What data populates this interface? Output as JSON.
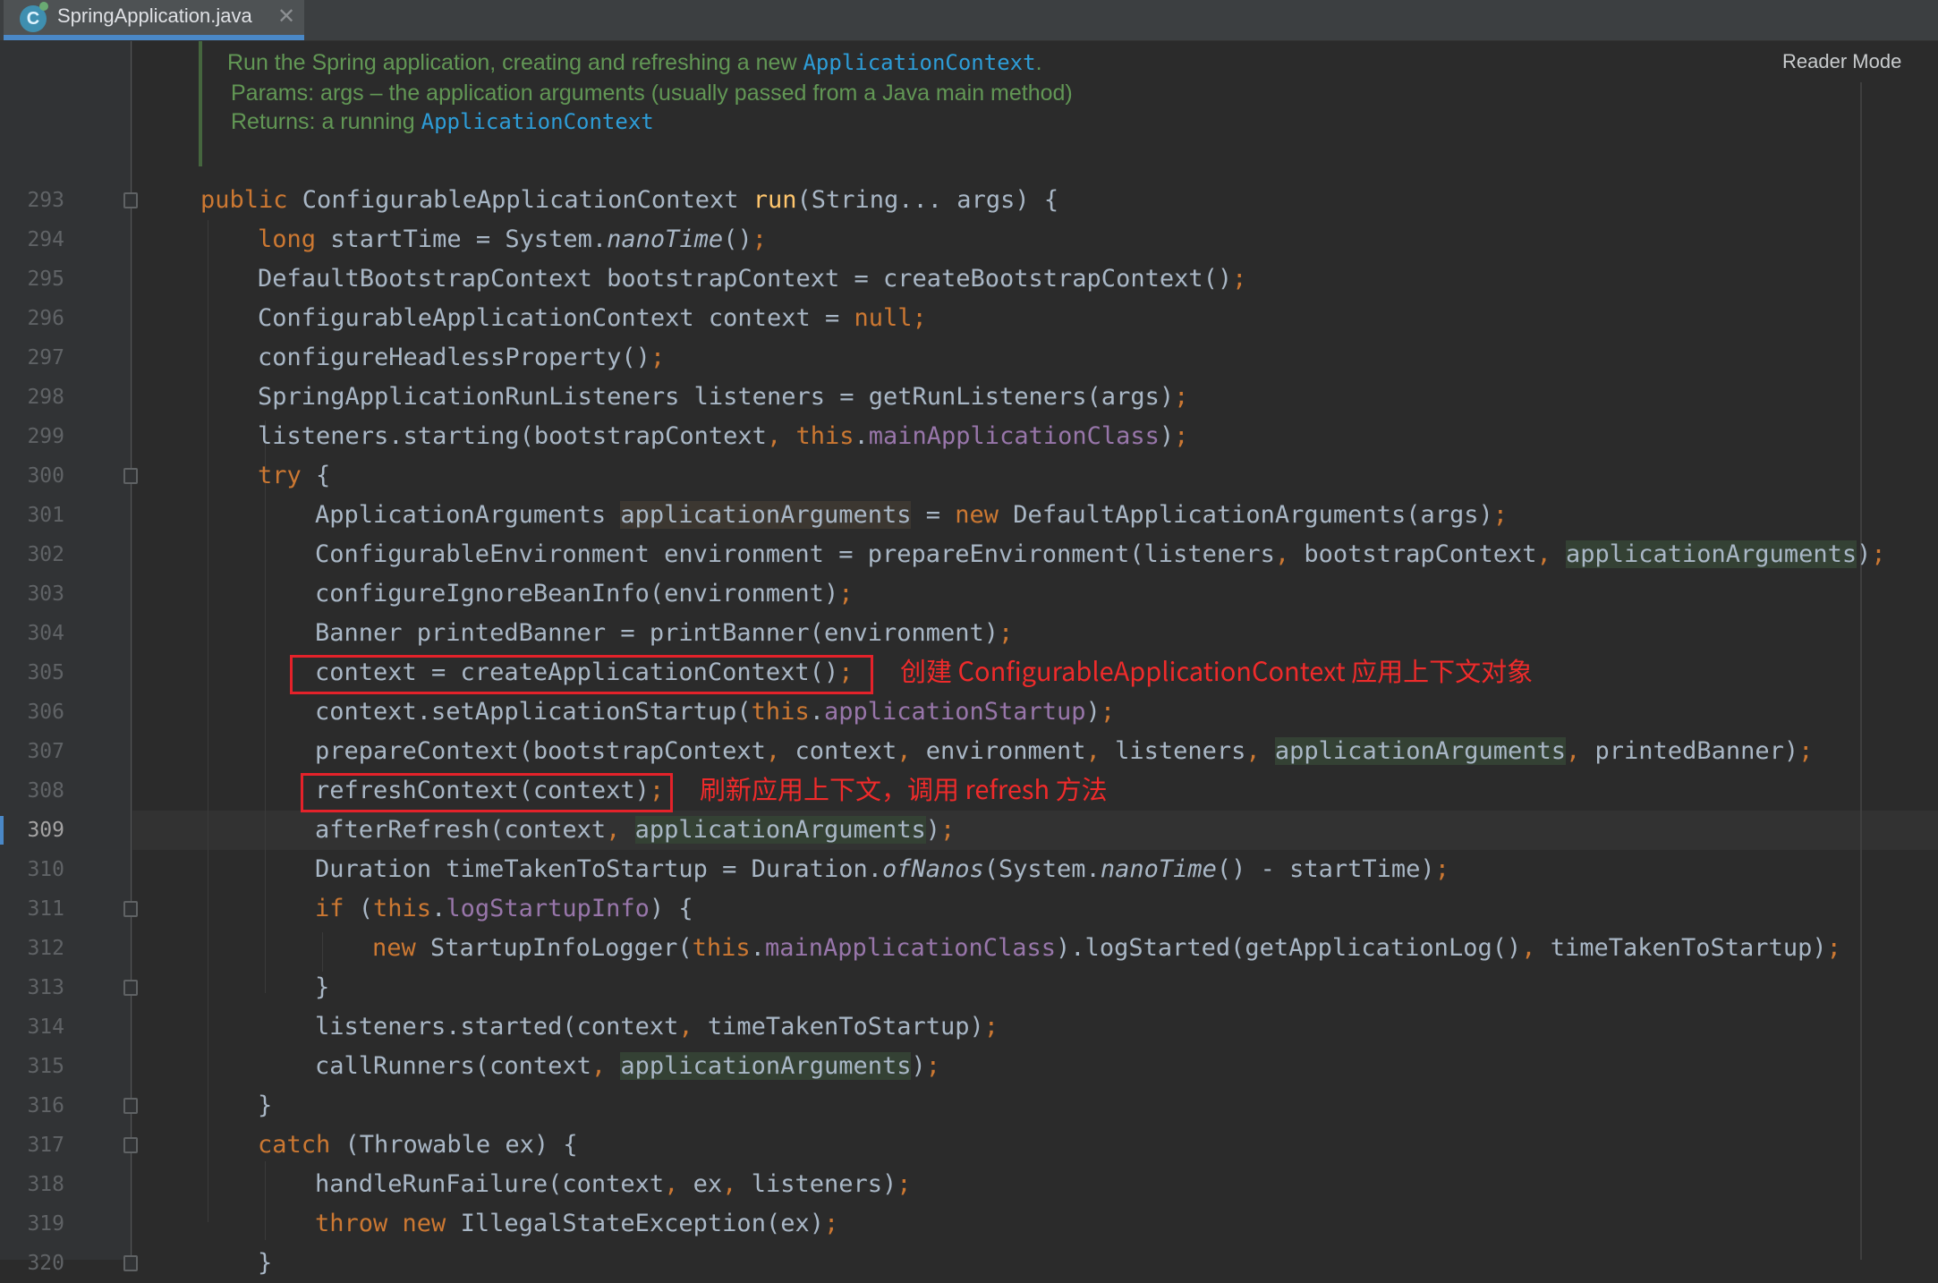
{
  "tab": {
    "title": "SpringApplication.java",
    "icon": "C",
    "close": "✕"
  },
  "reader_mode": "Reader Mode",
  "doc": {
    "summary_text": "Run the Spring application, creating and refreshing a new ",
    "summary_link": "ApplicationContext",
    "summary_end": ".",
    "params_label": "Params:",
    "params_text": "args – the application arguments (usually passed from a Java main method)",
    "returns_label": "Returns:",
    "returns_text": "a running ",
    "returns_link": "ApplicationContext"
  },
  "line_numbers": [
    "293",
    "294",
    "295",
    "296",
    "297",
    "298",
    "299",
    "300",
    "301",
    "302",
    "303",
    "304",
    "305",
    "306",
    "307",
    "308",
    "309",
    "310",
    "311",
    "312",
    "313",
    "314",
    "315",
    "316",
    "317",
    "318",
    "319",
    "320"
  ],
  "code": {
    "l293": [
      "public",
      " ConfigurableApplicationContext ",
      "run",
      "(String... args) {"
    ],
    "l294": [
      "long",
      " startTime = System.",
      "nanoTime",
      "()",
      ";"
    ],
    "l295": [
      "DefaultBootstrapContext bootstrapContext = createBootstrapContext()",
      ";"
    ],
    "l296": [
      "ConfigurableApplicationContext context = ",
      "null",
      ";"
    ],
    "l297": [
      "configureHeadlessProperty()",
      ";"
    ],
    "l298": [
      "SpringApplicationRunListeners listeners = getRunListeners(args)",
      ";"
    ],
    "l299": [
      "listeners.starting(bootstrapContext",
      ", ",
      "this",
      ".",
      "mainApplicationClass",
      ")",
      ";"
    ],
    "l300": [
      "try",
      " {"
    ],
    "l301": [
      "ApplicationArguments ",
      "applicationArguments",
      " = ",
      "new",
      " DefaultApplicationArguments(args)",
      ";"
    ],
    "l302": [
      "ConfigurableEnvironment environment = prepareEnvironment(listeners",
      ", ",
      "bootstrapContext",
      ", ",
      "applicationArguments",
      ")",
      ";"
    ],
    "l303": [
      "configureIgnoreBeanInfo(environment)",
      ";"
    ],
    "l304": [
      "Banner printedBanner = printBanner(environment)",
      ";"
    ],
    "l305": [
      "context = createApplicationContext()",
      ";"
    ],
    "l306": [
      "context.setApplicationStartup(",
      "this",
      ".",
      "applicationStartup",
      ")",
      ";"
    ],
    "l307": [
      "prepareContext(bootstrapContext",
      ", ",
      "context",
      ", ",
      "environment",
      ", ",
      "listeners",
      ", ",
      "applicationArguments",
      ", ",
      "printedBanner)",
      ";"
    ],
    "l308": [
      "refreshContext(context)",
      ";"
    ],
    "l309": [
      "afterRefresh(context",
      ", ",
      "applicationArguments",
      ")",
      ";"
    ],
    "l310": [
      "Duration timeTakenToStartup = Duration.",
      "ofNanos",
      "(System.",
      "nanoTime",
      "() - startTime)",
      ";"
    ],
    "l311": [
      "if",
      " (",
      "this",
      ".",
      "logStartupInfo",
      ") {"
    ],
    "l312": [
      "new",
      " StartupInfoLogger(",
      "this",
      ".",
      "mainApplicationClass",
      ").logStarted(getApplicationLog()",
      ", ",
      "timeTakenToStartup)",
      ";"
    ],
    "l313": [
      "}"
    ],
    "l314": [
      "listeners.started(context",
      ", ",
      "timeTakenToStartup)",
      ";"
    ],
    "l315": [
      "callRunners(context",
      ", ",
      "applicationArguments",
      ")",
      ";"
    ],
    "l316": [
      "}"
    ],
    "l317": [
      "catch",
      " (Throwable ex) {"
    ],
    "l318": [
      "handleRunFailure(context",
      ", ",
      "ex",
      ", ",
      "listeners)",
      ";"
    ],
    "l319": [
      "throw",
      " ",
      "new",
      " IllegalStateException(ex)",
      ";"
    ],
    "l320": [
      "}"
    ]
  },
  "annotations": {
    "a305": "创建 ConfigurableApplicationContext 应用上下文对象",
    "a308": "刷新应用上下文，调用 refresh 方法"
  },
  "colors": {
    "background": "#2b2b2b",
    "keyword": "#cc7832",
    "method_decl": "#ffc66d",
    "field": "#9876aa",
    "doc_text": "#629755",
    "doc_link": "#2d9dd8",
    "annotation_red": "#ef2b2b"
  }
}
